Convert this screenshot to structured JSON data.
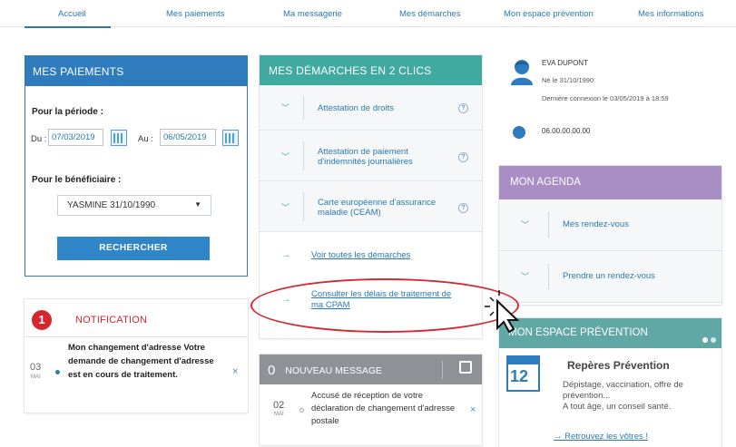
{
  "nav": {
    "tabs": [
      "Accueil",
      "Mes paiements",
      "Ma messagerie",
      "Mes démarches",
      "Mon espace prévention",
      "Mes informations"
    ]
  },
  "paiements": {
    "title": "MES PAIEMENTS",
    "periode_label": "Pour la période :",
    "du_label": "Du :",
    "du_value": "07/03/2019",
    "au_label": "Au :",
    "au_value": "06/05/2019",
    "beneficiaire_label": "Pour le bénéficiaire :",
    "beneficiaire_value": "YASMINE 31/10/1990",
    "search_button": "RECHERCHER"
  },
  "notification": {
    "count": "1",
    "title": "NOTIFICATION",
    "day": "03",
    "month": "MAI",
    "message": "Mon changement d'adresse Votre demande de changement d'adresse est en cours de traitement.",
    "close": "×"
  },
  "demarches": {
    "title": "MES DÉMARCHES EN 2 CLICS",
    "items": [
      {
        "label": "Attestation de droits",
        "help": "?"
      },
      {
        "label": "Attestation de paiement d'indemnités journalières",
        "help": "?"
      },
      {
        "label": "Carte européenne d'assurance maladie (CEAM)",
        "help": "?"
      }
    ],
    "link_all": "Voir toutes les démarches",
    "link_delais": "Consulter les délais de traitement de ma CPAM"
  },
  "message": {
    "count": "0",
    "title": "NOUVEAU MESSAGE",
    "day": "02",
    "month": "MAI",
    "text": "Accusé de réception de votre déclaration de changement d'adresse postale",
    "close": "×"
  },
  "profile": {
    "name": "EVA DUPONT",
    "born": "Né le 31/10/1990",
    "last_login": "Dernière connexion le 03/05/2019 à 18:59",
    "phone": "06.00.00.00.00"
  },
  "agenda": {
    "title": "MON AGENDA",
    "items": [
      "Mes rendez-vous",
      "Prendre un rendez-vous"
    ]
  },
  "prevention": {
    "title": "MON ESPACE PRÉVENTION",
    "cal_number": "12",
    "heading": "Repères Prévention",
    "desc1": "Dépistage, vaccination, offre de prévention...",
    "desc2": "A tout âge, un conseil santé.",
    "more": "→ Retrouvez les vôtres !"
  },
  "colors": {
    "blue": "#2e7bbd",
    "teal": "#40a9a0",
    "purple": "#a88ec4",
    "grey": "#8e9195",
    "red": "#d6262e"
  }
}
